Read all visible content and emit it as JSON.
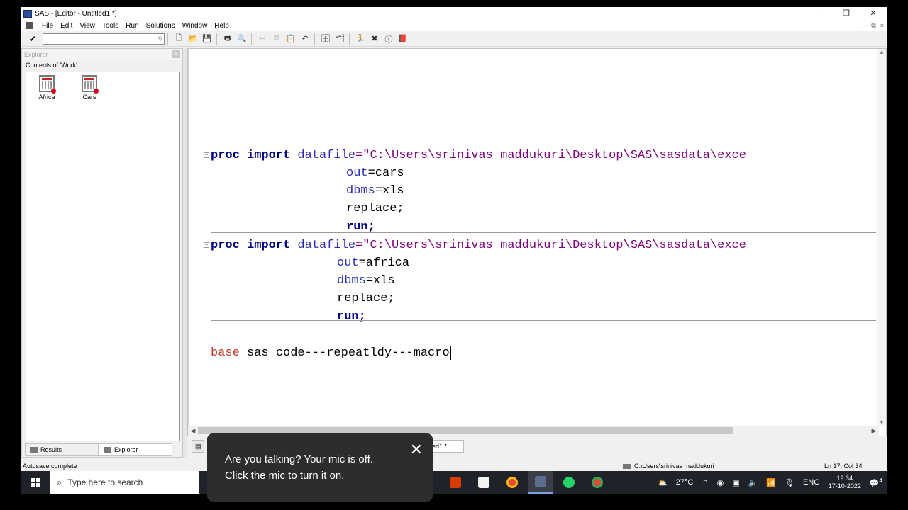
{
  "window": {
    "title": "SAS - [Editor - Untitled1 *]",
    "controls": [
      "─",
      "❐",
      "✕"
    ],
    "mdi_controls": [
      "–",
      "⧉",
      "×"
    ]
  },
  "menu": [
    "File",
    "Edit",
    "View",
    "Tools",
    "Run",
    "Solutions",
    "Window",
    "Help"
  ],
  "command_box": {
    "value": ""
  },
  "explorer": {
    "header": "Explorer",
    "contents_label": "Contents of 'Work'",
    "libraries": [
      "Africa",
      "Cars"
    ],
    "tabs": {
      "results": "Results",
      "explorer": "Explorer"
    }
  },
  "editor": {
    "block1": {
      "keyword": "proc import",
      "option": "datafile",
      "string": "=\"C:\\Users\\srinivas maddukuri\\Desktop\\SAS\\sasdata\\exce",
      "out_kw": "out",
      "out_val": "=cars",
      "dbms_kw": "dbms",
      "dbms_val": "=xls",
      "replace": "replace;",
      "run": "run;"
    },
    "block2": {
      "keyword": "proc import",
      "option": "datafile",
      "string": "=\"C:\\Users\\srinivas maddukuri\\Desktop\\SAS\\sasdata\\exce",
      "out_kw": "out",
      "out_val": "=africa",
      "dbms_kw": "dbms",
      "dbms_val": "=xls",
      "replace": "replace;",
      "run": "run;"
    },
    "note_kw": "base",
    "note_rest": " sas code---repeatldy---macro"
  },
  "window_tabs": {
    "editor_tab_suffix": "ed1 *"
  },
  "status": {
    "left": "Autosave complete",
    "path": "C:\\Users\\srinivas maddukuri",
    "position": "Ln 17, Col 34"
  },
  "taskbar": {
    "search_placeholder": "Type here to search",
    "weather": "27°C",
    "language": "ENG",
    "time": "19:34",
    "date": "17-10-2022",
    "notification_count": "4"
  },
  "toast": {
    "line1": "Are you talking? Your mic is off.",
    "line2": "Click the mic to turn it on."
  }
}
